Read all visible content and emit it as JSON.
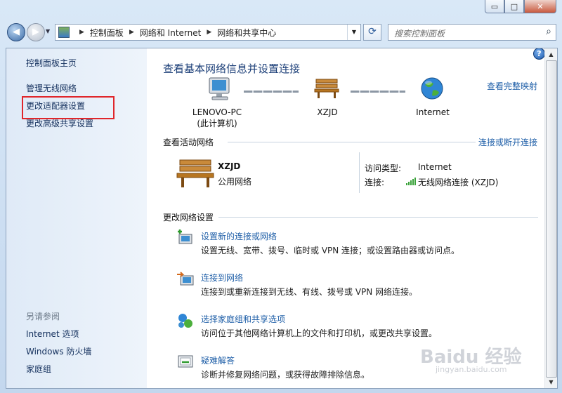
{
  "window": {
    "min_label": "▭",
    "max_label": "□",
    "close_label": "✕"
  },
  "address": {
    "crumbs": [
      "控制面板",
      "网络和 Internet",
      "网络和共享中心"
    ]
  },
  "search": {
    "placeholder": "搜索控制面板"
  },
  "sidebar": {
    "items": [
      "控制面板主页",
      "管理无线网络",
      "更改适配器设置",
      "更改高级共享设置"
    ],
    "see_also_label": "另请参阅",
    "see_also": [
      "Internet 选项",
      "Windows 防火墙",
      "家庭组"
    ]
  },
  "main": {
    "title": "查看基本网络信息并设置连接",
    "full_map_link": "查看完整映射",
    "map": {
      "computer": "LENOVO-PC",
      "computer_sub": "(此计算机)",
      "network": "XZJD",
      "internet": "Internet"
    },
    "active": {
      "heading": "查看活动网络",
      "connect_link": "连接或断开连接",
      "network_name": "XZJD",
      "network_type": "公用网络",
      "access_label": "访问类型:",
      "access_value": "Internet",
      "conn_label": "连接:",
      "conn_value": "无线网络连接 (XZJD)"
    },
    "change": {
      "heading": "更改网络设置",
      "tasks": [
        {
          "title": "设置新的连接或网络",
          "desc": "设置无线、宽带、拨号、临时或 VPN 连接；或设置路由器或访问点。"
        },
        {
          "title": "连接到网络",
          "desc": "连接到或重新连接到无线、有线、拨号或 VPN 网络连接。"
        },
        {
          "title": "选择家庭组和共享选项",
          "desc": "访问位于其他网络计算机上的文件和打印机，或更改共享设置。"
        },
        {
          "title": "疑难解答",
          "desc": "诊断并修复网络问题，或获得故障排除信息。"
        }
      ]
    }
  },
  "watermark": {
    "text": "Baidu 经验",
    "sub": "jingyan.baidu.com"
  },
  "colors": {
    "link": "#1f5fa8",
    "highlight": "#e0262b",
    "title": "#1c3f78"
  }
}
